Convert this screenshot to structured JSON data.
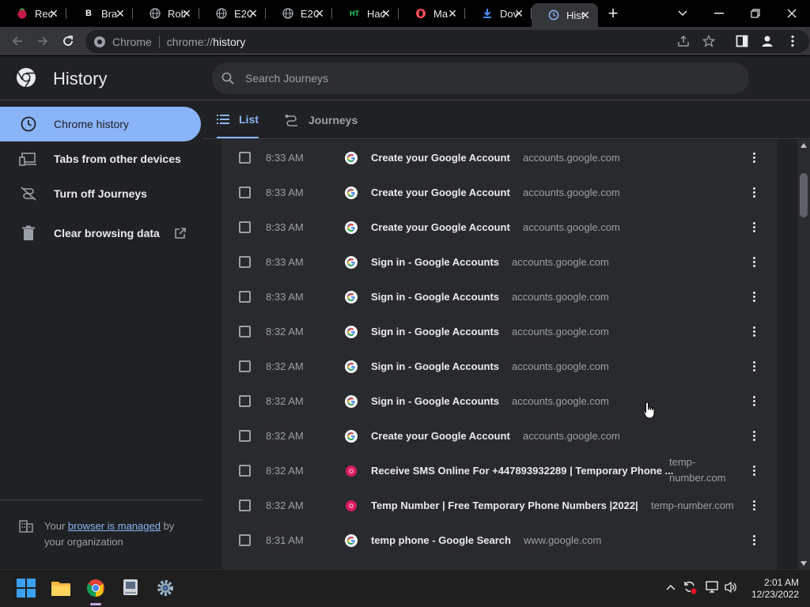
{
  "tabs": [
    {
      "label": "Rec",
      "icon": "raspberry-icon",
      "icon_color": "#c51a4a"
    },
    {
      "label": "Bra",
      "icon": "b-logo-icon",
      "icon_color": "#ffffff"
    },
    {
      "label": "Rob",
      "icon": "globe-icon",
      "icon_color": "#9aa0a6"
    },
    {
      "label": "E2G",
      "icon": "globe-icon",
      "icon_color": "#9aa0a6"
    },
    {
      "label": "E2G",
      "icon": "globe-icon",
      "icon_color": "#9aa0a6"
    },
    {
      "label": "Hac",
      "icon": "ht-logo-icon",
      "icon_color": "#1ed760"
    },
    {
      "label": "Ma",
      "icon": "opera-icon",
      "icon_color": "#ff4b55"
    },
    {
      "label": "Dov",
      "icon": "download-icon",
      "icon_color": "#4c8bf5"
    },
    {
      "label": "Hist",
      "icon": "history-icon",
      "icon_color": "#8ab4f8",
      "active": true
    }
  ],
  "tab_close_glyph": "✕",
  "new_tab_glyph": "+",
  "window": {
    "dropdown": "⌵",
    "minimize": "—",
    "restore": "❐",
    "close": "✕"
  },
  "omnibox": {
    "site": "Chrome",
    "url_prefix": "chrome://",
    "url_path": "history"
  },
  "header": {
    "title": "History",
    "search_placeholder": "Search Journeys"
  },
  "sidebar": {
    "items": [
      {
        "label": "Chrome history",
        "icon": "clock-icon",
        "active": true
      },
      {
        "label": "Tabs from other devices",
        "icon": "devices-icon"
      },
      {
        "label": "Turn off Journeys",
        "icon": "journeys-off-icon"
      },
      {
        "label": "Clear browsing data",
        "icon": "trash-icon"
      }
    ],
    "managed_prefix": "Your ",
    "managed_link": "browser is managed",
    "managed_suffix": " by your organization"
  },
  "view_tabs": {
    "list": "List",
    "journeys": "Journeys"
  },
  "history": [
    {
      "time": "8:33 AM",
      "title": "Create your Google Account",
      "domain": "accounts.google.com",
      "fav": "google"
    },
    {
      "time": "8:33 AM",
      "title": "Create your Google Account",
      "domain": "accounts.google.com",
      "fav": "google"
    },
    {
      "time": "8:33 AM",
      "title": "Create your Google Account",
      "domain": "accounts.google.com",
      "fav": "google"
    },
    {
      "time": "8:33 AM",
      "title": "Sign in - Google Accounts",
      "domain": "accounts.google.com",
      "fav": "google"
    },
    {
      "time": "8:33 AM",
      "title": "Sign in - Google Accounts",
      "domain": "accounts.google.com",
      "fav": "google"
    },
    {
      "time": "8:32 AM",
      "title": "Sign in - Google Accounts",
      "domain": "accounts.google.com",
      "fav": "google"
    },
    {
      "time": "8:32 AM",
      "title": "Sign in - Google Accounts",
      "domain": "accounts.google.com",
      "fav": "google"
    },
    {
      "time": "8:32 AM",
      "title": "Sign in - Google Accounts",
      "domain": "accounts.google.com",
      "fav": "google"
    },
    {
      "time": "8:32 AM",
      "title": "Create your Google Account",
      "domain": "accounts.google.com",
      "fav": "google"
    },
    {
      "time": "8:32 AM",
      "title": "Receive SMS Online For +447893932289 | Temporary Phone ...",
      "domain": "temp-number.com",
      "domain_line1": "temp-",
      "domain_line2": "number.com",
      "fav": "temp"
    },
    {
      "time": "8:32 AM",
      "title": "Temp Number | Free Temporary Phone Numbers |2022|",
      "domain": "temp-number.com",
      "fav": "temp"
    },
    {
      "time": "8:31 AM",
      "title": "temp phone - Google Search",
      "domain": "www.google.com",
      "fav": "google"
    }
  ],
  "taskbar": {
    "time": "2:01 AM",
    "date": "12/23/2022"
  },
  "colors": {
    "accent": "#8ab4f8",
    "background": "#202124",
    "card": "#292a2d"
  }
}
